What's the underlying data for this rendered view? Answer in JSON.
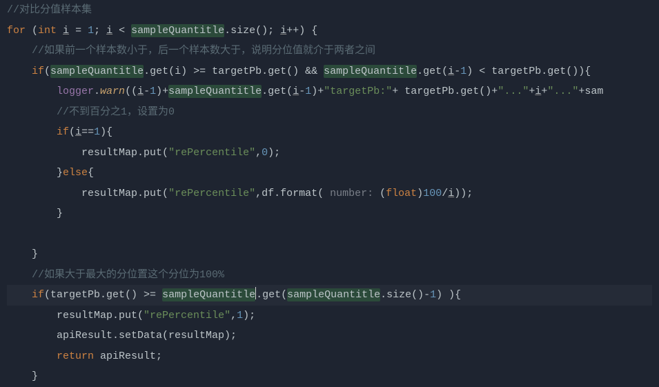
{
  "editor": {
    "lines": [
      {
        "indent": 0,
        "current": false,
        "tokens": [
          {
            "cls": "c-comment",
            "text": "//对比分值样本集"
          }
        ]
      },
      {
        "indent": 0,
        "current": false,
        "tokens": [
          {
            "cls": "c-keyword",
            "text": "for "
          },
          {
            "cls": "c-punct",
            "text": "("
          },
          {
            "cls": "c-type",
            "text": "int "
          },
          {
            "cls": "c-var c-underline",
            "text": "i"
          },
          {
            "cls": "c-punct",
            "text": " = "
          },
          {
            "cls": "c-number",
            "text": "1"
          },
          {
            "cls": "c-punct",
            "text": "; "
          },
          {
            "cls": "c-var c-underline",
            "text": "i"
          },
          {
            "cls": "c-punct",
            "text": " < "
          },
          {
            "cls": "c-var c-hl",
            "text": "sampleQuantitle"
          },
          {
            "cls": "c-punct",
            "text": ".size(); "
          },
          {
            "cls": "c-var c-underline",
            "text": "i"
          },
          {
            "cls": "c-punct",
            "text": "++) {"
          }
        ]
      },
      {
        "indent": 1,
        "current": false,
        "tokens": [
          {
            "cls": "c-comment",
            "text": "//如果前一个样本数小于，后一个样本数大于，说明分位值就介于两者之间"
          }
        ]
      },
      {
        "indent": 1,
        "current": false,
        "tokens": [
          {
            "cls": "c-keyword",
            "text": "if"
          },
          {
            "cls": "c-punct",
            "text": "("
          },
          {
            "cls": "c-var c-hl",
            "text": "sampleQuantitle"
          },
          {
            "cls": "c-punct",
            "text": ".get(i) >= targetPb.get() && "
          },
          {
            "cls": "c-var c-hl",
            "text": "sampleQuantitle"
          },
          {
            "cls": "c-punct",
            "text": ".get("
          },
          {
            "cls": "c-var c-underline",
            "text": "i"
          },
          {
            "cls": "c-punct",
            "text": "-"
          },
          {
            "cls": "c-number",
            "text": "1"
          },
          {
            "cls": "c-punct",
            "text": ") < targetPb.get()){"
          }
        ]
      },
      {
        "indent": 2,
        "current": false,
        "tokens": [
          {
            "cls": "c-ident",
            "text": "logger"
          },
          {
            "cls": "c-punct",
            "text": "."
          },
          {
            "cls": "c-warn",
            "text": "warn"
          },
          {
            "cls": "c-punct",
            "text": "(("
          },
          {
            "cls": "c-var c-underline",
            "text": "i"
          },
          {
            "cls": "c-punct",
            "text": "-"
          },
          {
            "cls": "c-number",
            "text": "1"
          },
          {
            "cls": "c-punct",
            "text": ")+"
          },
          {
            "cls": "c-var c-hl",
            "text": "sampleQuantitle"
          },
          {
            "cls": "c-punct",
            "text": ".get("
          },
          {
            "cls": "c-var c-underline",
            "text": "i"
          },
          {
            "cls": "c-punct",
            "text": "-"
          },
          {
            "cls": "c-number",
            "text": "1"
          },
          {
            "cls": "c-punct",
            "text": ")+"
          },
          {
            "cls": "c-string",
            "text": "\"targetPb:\""
          },
          {
            "cls": "c-punct",
            "text": "+ targetPb.get()+"
          },
          {
            "cls": "c-string",
            "text": "\"...\""
          },
          {
            "cls": "c-punct",
            "text": "+"
          },
          {
            "cls": "c-var c-underline",
            "text": "i"
          },
          {
            "cls": "c-punct",
            "text": "+"
          },
          {
            "cls": "c-string",
            "text": "\"...\""
          },
          {
            "cls": "c-punct",
            "text": "+sam"
          }
        ]
      },
      {
        "indent": 2,
        "current": false,
        "tokens": [
          {
            "cls": "c-comment",
            "text": "//不到百分之1，设置为0"
          }
        ]
      },
      {
        "indent": 2,
        "current": false,
        "tokens": [
          {
            "cls": "c-keyword",
            "text": "if"
          },
          {
            "cls": "c-punct",
            "text": "("
          },
          {
            "cls": "c-var c-underline",
            "text": "i"
          },
          {
            "cls": "c-punct",
            "text": "=="
          },
          {
            "cls": "c-number",
            "text": "1"
          },
          {
            "cls": "c-punct",
            "text": "){"
          }
        ]
      },
      {
        "indent": 3,
        "current": false,
        "tokens": [
          {
            "cls": "c-var",
            "text": "resultMap"
          },
          {
            "cls": "c-punct",
            "text": ".put("
          },
          {
            "cls": "c-string",
            "text": "\"rePercentile\""
          },
          {
            "cls": "c-punct",
            "text": ","
          },
          {
            "cls": "c-number",
            "text": "0"
          },
          {
            "cls": "c-punct",
            "text": ");"
          }
        ]
      },
      {
        "indent": 2,
        "current": false,
        "tokens": [
          {
            "cls": "c-punct",
            "text": "}"
          },
          {
            "cls": "c-keyword",
            "text": "else"
          },
          {
            "cls": "c-punct",
            "text": "{"
          }
        ]
      },
      {
        "indent": 3,
        "current": false,
        "tokens": [
          {
            "cls": "c-var",
            "text": "resultMap"
          },
          {
            "cls": "c-punct",
            "text": ".put("
          },
          {
            "cls": "c-string",
            "text": "\"rePercentile\""
          },
          {
            "cls": "c-punct",
            "text": ",df.format( "
          },
          {
            "cls": "c-hint",
            "text": "number: "
          },
          {
            "cls": "c-punct",
            "text": "("
          },
          {
            "cls": "c-keyword",
            "text": "float"
          },
          {
            "cls": "c-punct",
            "text": ")"
          },
          {
            "cls": "c-number",
            "text": "100"
          },
          {
            "cls": "c-punct",
            "text": "/"
          },
          {
            "cls": "c-var c-underline",
            "text": "i"
          },
          {
            "cls": "c-punct",
            "text": "));"
          }
        ]
      },
      {
        "indent": 2,
        "current": false,
        "tokens": [
          {
            "cls": "c-punct",
            "text": "}"
          }
        ]
      },
      {
        "indent": 0,
        "current": false,
        "tokens": []
      },
      {
        "indent": 1,
        "current": false,
        "tokens": [
          {
            "cls": "c-punct",
            "text": "}"
          }
        ]
      },
      {
        "indent": 1,
        "current": false,
        "tokens": [
          {
            "cls": "c-comment",
            "text": "//如果大于最大的分位置这个分位为100%"
          }
        ]
      },
      {
        "indent": 1,
        "current": true,
        "tokens": [
          {
            "cls": "c-keyword",
            "text": "if"
          },
          {
            "cls": "c-punct",
            "text": "(targetPb.get() >= "
          },
          {
            "cls": "c-var c-hl",
            "text": "sampleQuantitle"
          },
          {
            "cursor": true
          },
          {
            "cls": "c-punct",
            "text": ".get("
          },
          {
            "cls": "c-var c-hl",
            "text": "sampleQuantitle"
          },
          {
            "cls": "c-punct",
            "text": ".size()-"
          },
          {
            "cls": "c-number",
            "text": "1"
          },
          {
            "cls": "c-punct",
            "text": ") ){"
          }
        ]
      },
      {
        "indent": 2,
        "current": false,
        "tokens": [
          {
            "cls": "c-var",
            "text": "resultMap"
          },
          {
            "cls": "c-punct",
            "text": ".put("
          },
          {
            "cls": "c-string",
            "text": "\"rePercentile\""
          },
          {
            "cls": "c-punct",
            "text": ","
          },
          {
            "cls": "c-number",
            "text": "1"
          },
          {
            "cls": "c-punct",
            "text": ");"
          }
        ]
      },
      {
        "indent": 2,
        "current": false,
        "tokens": [
          {
            "cls": "c-var",
            "text": "apiResult"
          },
          {
            "cls": "c-punct",
            "text": ".setData(resultMap);"
          }
        ]
      },
      {
        "indent": 2,
        "current": false,
        "tokens": [
          {
            "cls": "c-keyword",
            "text": "return "
          },
          {
            "cls": "c-var",
            "text": "apiResult"
          },
          {
            "cls": "c-punct",
            "text": ";"
          }
        ]
      },
      {
        "indent": 1,
        "current": false,
        "tokens": [
          {
            "cls": "c-punct",
            "text": "}"
          }
        ]
      }
    ],
    "indent_unit": "    "
  }
}
